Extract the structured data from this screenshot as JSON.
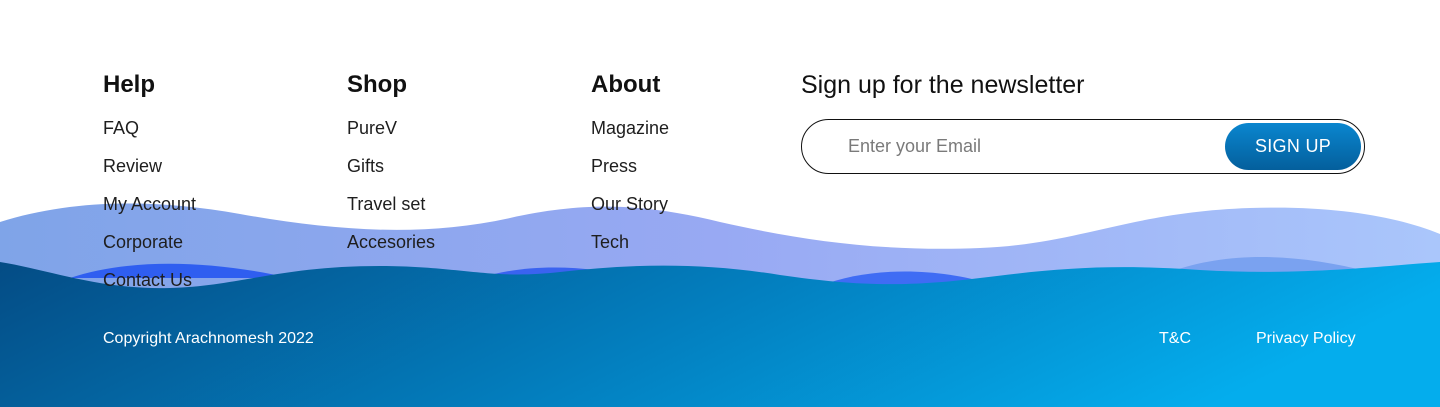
{
  "columns": [
    {
      "title": "Help",
      "links": [
        "FAQ",
        "Review",
        "My Account",
        "Corporate",
        "Contact Us"
      ]
    },
    {
      "title": "Shop",
      "links": [
        "PureV",
        "Gifts",
        "Travel set",
        "Accesories"
      ]
    },
    {
      "title": "About",
      "links": [
        "Magazine",
        "Press",
        "Our Story",
        "Tech"
      ]
    }
  ],
  "newsletter": {
    "title": "Sign up for the newsletter",
    "email_placeholder": "Enter your Email",
    "button_label": "SIGN UP"
  },
  "bottom": {
    "copyright": "Copyright Arachnomesh 2022",
    "terms_label": "T&C",
    "privacy_label": "Privacy Policy"
  },
  "colors": {
    "wave_light_start": "#7fa4e8",
    "wave_light_end": "#aac6fb",
    "wave_mid": "#2f5ef0",
    "wave_dark_start": "#044c85",
    "wave_dark_end": "#04aded",
    "button": "#0a86cf"
  }
}
